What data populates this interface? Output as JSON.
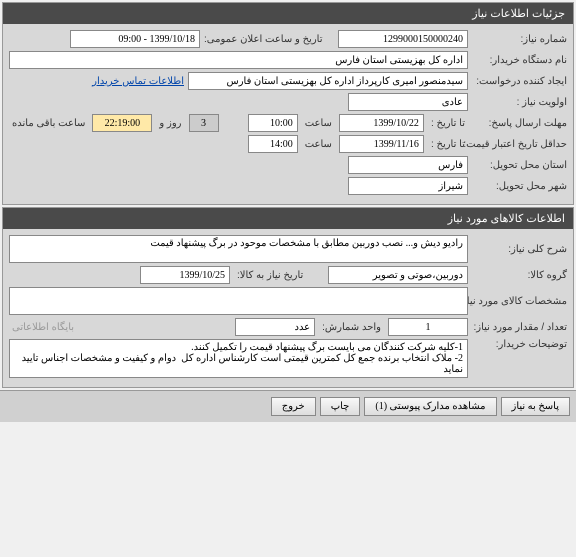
{
  "panel1": {
    "title": "جزئیات اطلاعات نیاز",
    "need_number_label": "شماره نیاز:",
    "need_number": "1299000150000240",
    "public_datetime_label": "تاریخ و ساعت اعلان عمومی:",
    "public_datetime": "1399/10/18 - 09:00",
    "buyer_org_label": "نام دستگاه خریدار:",
    "buyer_org": "اداره کل بهزیستی استان فارس",
    "requester_label": "ایجاد کننده درخواست:",
    "requester": "سیدمنصور امیری کارپرداز اداره کل بهزیستی استان فارس",
    "contact_link": "اطلاعات تماس خریدار",
    "priority_label": "اولویت نیاز :",
    "priority": "عادی",
    "deadline_label": "مهلت ارسال پاسخ:",
    "until_date_label": "تا تاریخ :",
    "until_date": "1399/10/22",
    "time_label": "ساعت",
    "until_time": "10:00",
    "days_label": "روز و",
    "days_count": "3",
    "remaining_time": "22:19:00",
    "remaining_label": "ساعت باقی مانده",
    "min_price_date_label": "حداقل تاریخ اعتبار قیمت:",
    "min_price_until_label": "تا تاریخ :",
    "min_price_date": "1399/11/16",
    "min_price_time": "14:00",
    "delivery_province_label": "استان محل تحویل:",
    "delivery_province": "فارس",
    "delivery_city_label": "شهر محل تحویل:",
    "delivery_city": "شیراز"
  },
  "panel2": {
    "title": "اطلاعات کالاهای مورد نیاز",
    "general_desc_label": "شرح کلی نیاز:",
    "general_desc": "رادیو دیش و... نصب دوربین مطابق با مشخصات موحود در برگ پیشنهاد قیمت",
    "goods_group_label": "گروه کالا:",
    "goods_group": "دوربین،صوتی و تصویر",
    "need_until_label": "تاریخ نیاز به کالا:",
    "need_until": "1399/10/25",
    "goods_spec_label": "مشخصات کالای مورد نیاز:",
    "goods_spec": "",
    "quantity_label": "تعداد / مقدار مورد نیاز:",
    "quantity": "1",
    "unit_label": "واحد شمارش:",
    "unit": "عدد",
    "barcode_label": "بایگاه اطلاعاتی",
    "buyer_notes_label": "توضیحات خریدار:",
    "buyer_notes": "1-کلیه شرکت کنندگان می بایست برگ پیشنهاد قیمت را تکمیل کنند.\n2- ملاک انتخاب برنده جمع کل کمترین قیمتی است کارشناس اداره کل  دوام و کیفیت و مشخصات اجناس تایید نماید"
  },
  "buttons": {
    "reply": "پاسخ به نیاز",
    "attachments": "مشاهده مدارک پیوستی (1)",
    "print": "چاپ",
    "exit": "خروج"
  }
}
